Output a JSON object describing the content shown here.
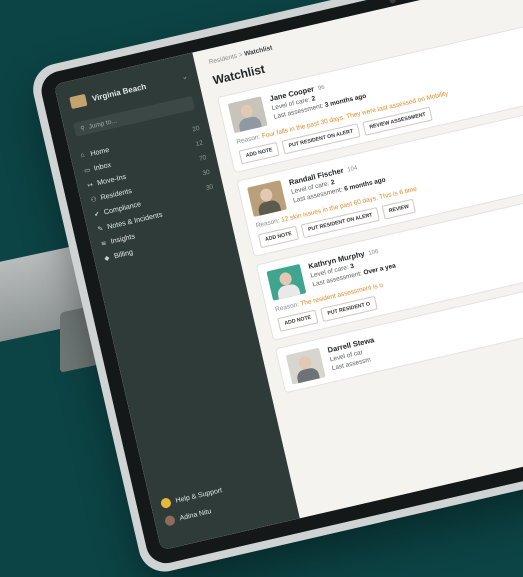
{
  "sidebar": {
    "org_name": "Virginia Beach",
    "search_placeholder": "Jump to...",
    "items": [
      {
        "label": "Home",
        "count": "20"
      },
      {
        "label": "Inbox",
        "count": "12"
      },
      {
        "label": "Move-Ins",
        "count": "70"
      },
      {
        "label": "Residents",
        "count": "30"
      },
      {
        "label": "Compliance",
        "count": "30"
      },
      {
        "label": "Notes & Incidents",
        "count": ""
      },
      {
        "label": "Insights",
        "count": ""
      },
      {
        "label": "Billing",
        "count": ""
      }
    ],
    "help": "Help & Support",
    "user": "Adina Nitu"
  },
  "breadcrumb": {
    "parent": "Residents",
    "sep": ">",
    "current": "Watchlist"
  },
  "page_title": "Watchlist",
  "residents": [
    {
      "name": "Jane Cooper",
      "room": "96",
      "level_label": "Level of care:",
      "level": "2",
      "assess_label": "Last assessment:",
      "assess": "3 months ago",
      "reason_label": "Reason:",
      "reason": "Four falls in the past 30 days. They were last assessed on Mobility",
      "btn_note": "ADD NOTE",
      "btn_alert": "PUT RESIDENT ON ALERT",
      "btn_review": "REVIEW ASSESSMENT"
    },
    {
      "name": "Randall Fischer",
      "room": "104",
      "level_label": "Level of care:",
      "level": "2",
      "assess_label": "Last assessment:",
      "assess": "6 months ago",
      "reason_label": "Reason:",
      "reason": "12 skin issues in the past 60 days. This is 6 time",
      "btn_note": "ADD NOTE",
      "btn_alert": "PUT RESIDENT ON ALERT",
      "btn_review": "REVIEW"
    },
    {
      "name": "Kathryn Murphy",
      "room": "106",
      "level_label": "Level of care:",
      "level": "3",
      "assess_label": "Last assessment:",
      "assess": "Over a yea",
      "reason_label": "Reason:",
      "reason": "The resident assessment is o",
      "btn_note": "ADD NOTE",
      "btn_alert": "PUT RESIDENT O",
      "btn_review": ""
    },
    {
      "name": "Darrell Stewa",
      "room": "",
      "level_label": "Level of car",
      "level": "",
      "assess_label": "Last assessm",
      "assess": "",
      "reason_label": "",
      "reason": "",
      "btn_note": "",
      "btn_alert": "",
      "btn_review": ""
    }
  ]
}
